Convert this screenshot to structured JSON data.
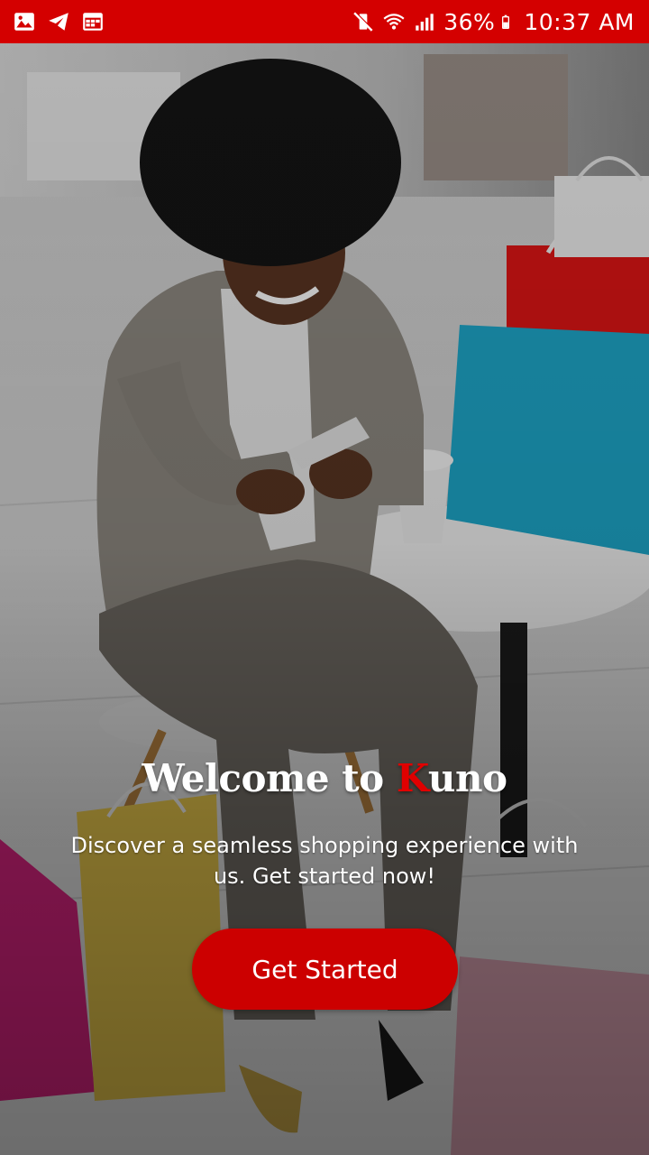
{
  "status_bar": {
    "left_icons": [
      "image-icon",
      "telegram-icon",
      "calendar-icon"
    ],
    "right_icons": [
      "mute-vibrate-icon",
      "wifi-icon",
      "signal-icon",
      "battery-icon"
    ],
    "battery": "36%",
    "time": "10:37 AM",
    "background": "#d40000"
  },
  "background": {
    "description_icon": "woman-shopping-photo"
  },
  "welcome": {
    "prefix": "Welcome to ",
    "brand_first_letter": "K",
    "brand_rest": "uno",
    "subtitle": "Discover a seamless shopping experience with us. Get started now!"
  },
  "cta": {
    "label": "Get Started",
    "color": "#cc0000"
  },
  "colors": {
    "accent": "#cc0000",
    "brand_letter": "#e00000"
  }
}
